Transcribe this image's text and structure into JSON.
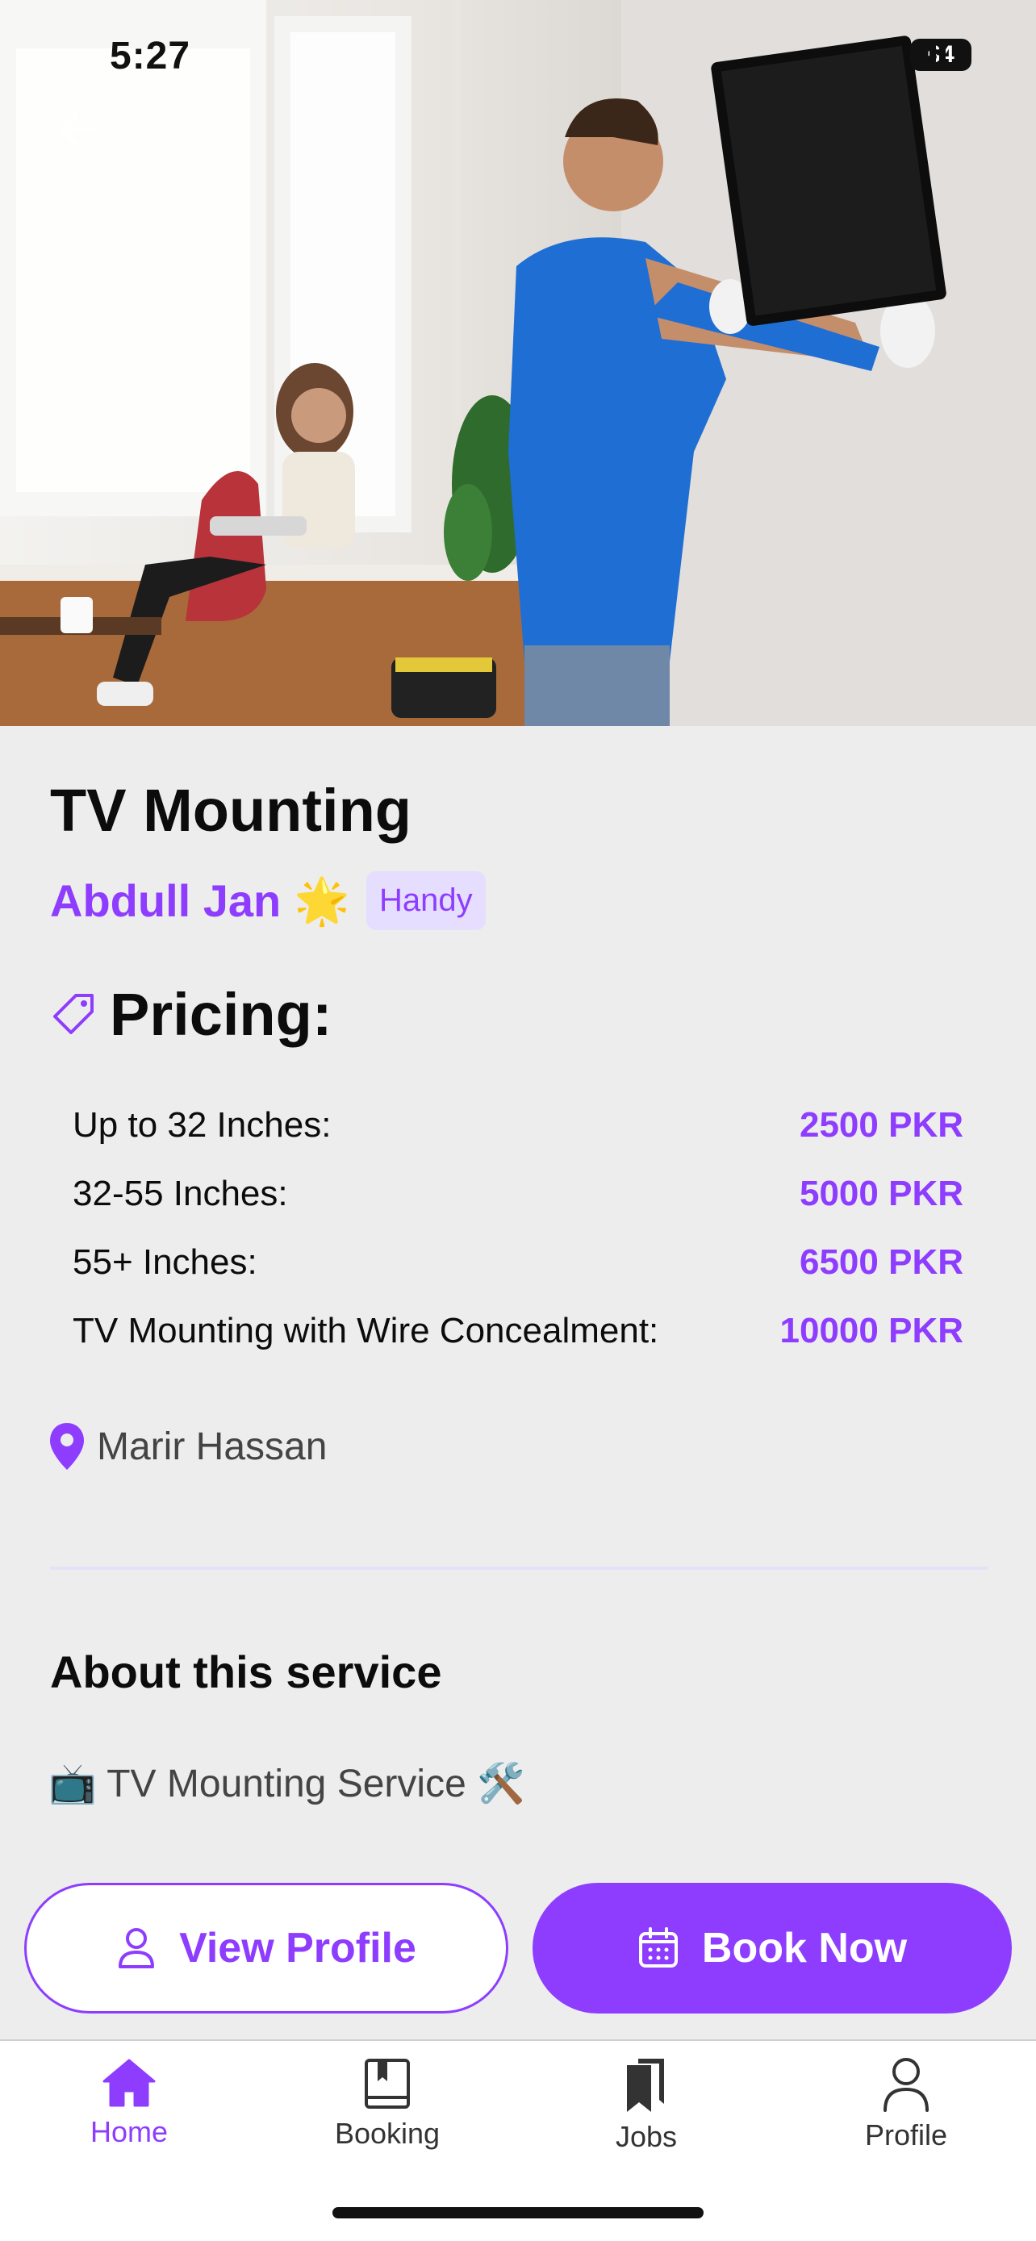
{
  "status_bar": {
    "time": "5:27",
    "battery": "64"
  },
  "service": {
    "title": "TV Mounting",
    "provider_name": "Abdull Jan",
    "provider_emoji": "🌟",
    "category_badge": "Handy"
  },
  "pricing": {
    "heading": "Pricing:",
    "items": [
      {
        "label": "Up to 32 Inches:",
        "value": "2500 PKR"
      },
      {
        "label": "32-55 Inches:",
        "value": "5000 PKR"
      },
      {
        "label": "55+ Inches:",
        "value": "6500 PKR"
      },
      {
        "label": "TV Mounting with Wire Concealment:",
        "value": "10000 PKR"
      }
    ]
  },
  "location": {
    "text": "Marir Hassan"
  },
  "about": {
    "title": "About this service",
    "text": "📺 TV Mounting Service 🛠️"
  },
  "actions": {
    "view_profile": "View Profile",
    "book_now": "Book Now"
  },
  "tabbar": {
    "home": "Home",
    "booking": "Booking",
    "jobs": "Jobs",
    "profile": "Profile"
  },
  "colors": {
    "accent": "#8e3dff",
    "badge_bg": "#e6deff",
    "page_bg": "#ededed"
  },
  "icons": [
    "back-arrow-icon",
    "price-tag-icon",
    "location-pin-icon",
    "user-icon",
    "calendar-icon",
    "home-icon",
    "book-icon",
    "bookmarks-icon",
    "profile-icon"
  ]
}
